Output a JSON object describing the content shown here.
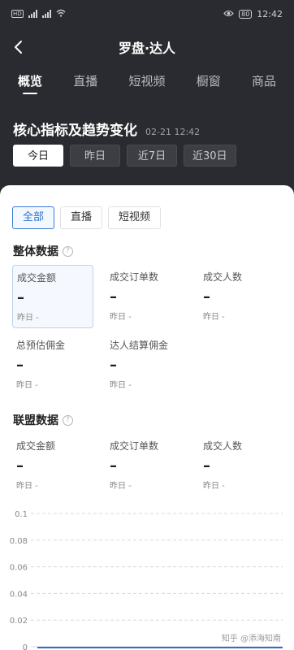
{
  "status": {
    "time": "12:42",
    "battery": "80",
    "left_badge": "HD"
  },
  "nav": {
    "title": "罗盘·达人"
  },
  "tabs": [
    {
      "label": "概览",
      "active": true
    },
    {
      "label": "直播",
      "active": false
    },
    {
      "label": "短视频",
      "active": false
    },
    {
      "label": "橱窗",
      "active": false
    },
    {
      "label": "商品",
      "active": false
    }
  ],
  "section": {
    "title": "核心指标及趋势变化",
    "time": "02-21 12:42"
  },
  "ranges": [
    "今日",
    "昨日",
    "近7日",
    "近30日"
  ],
  "segments": [
    "全部",
    "直播",
    "短视频"
  ],
  "overall": {
    "title": "整体数据",
    "metrics": [
      {
        "label": "成交金额",
        "value": "–",
        "sub": "昨日 -"
      },
      {
        "label": "成交订单数",
        "value": "–",
        "sub": "昨日 -"
      },
      {
        "label": "成交人数",
        "value": "–",
        "sub": "昨日 -"
      },
      {
        "label": "总预估佣金",
        "value": "–",
        "sub": "昨日 -"
      },
      {
        "label": "达人结算佣金",
        "value": "–",
        "sub": "昨日 -"
      }
    ]
  },
  "alliance": {
    "title": "联盟数据",
    "metrics": [
      {
        "label": "成交金额",
        "value": "–",
        "sub": "昨日 -"
      },
      {
        "label": "成交订单数",
        "value": "–",
        "sub": "昨日 -"
      },
      {
        "label": "成交人数",
        "value": "–",
        "sub": "昨日 -"
      }
    ]
  },
  "chart_data": {
    "type": "line",
    "y_ticks": [
      "0.1",
      "0.08",
      "0.06",
      "0.04",
      "0.02",
      "0"
    ],
    "ylim": [
      0,
      0.1
    ],
    "grid": true,
    "series": []
  },
  "watermark": "知乎 @添海知南",
  "colors": {
    "accent": "#2f6fd0",
    "dark_bg": "#2a2b30"
  }
}
